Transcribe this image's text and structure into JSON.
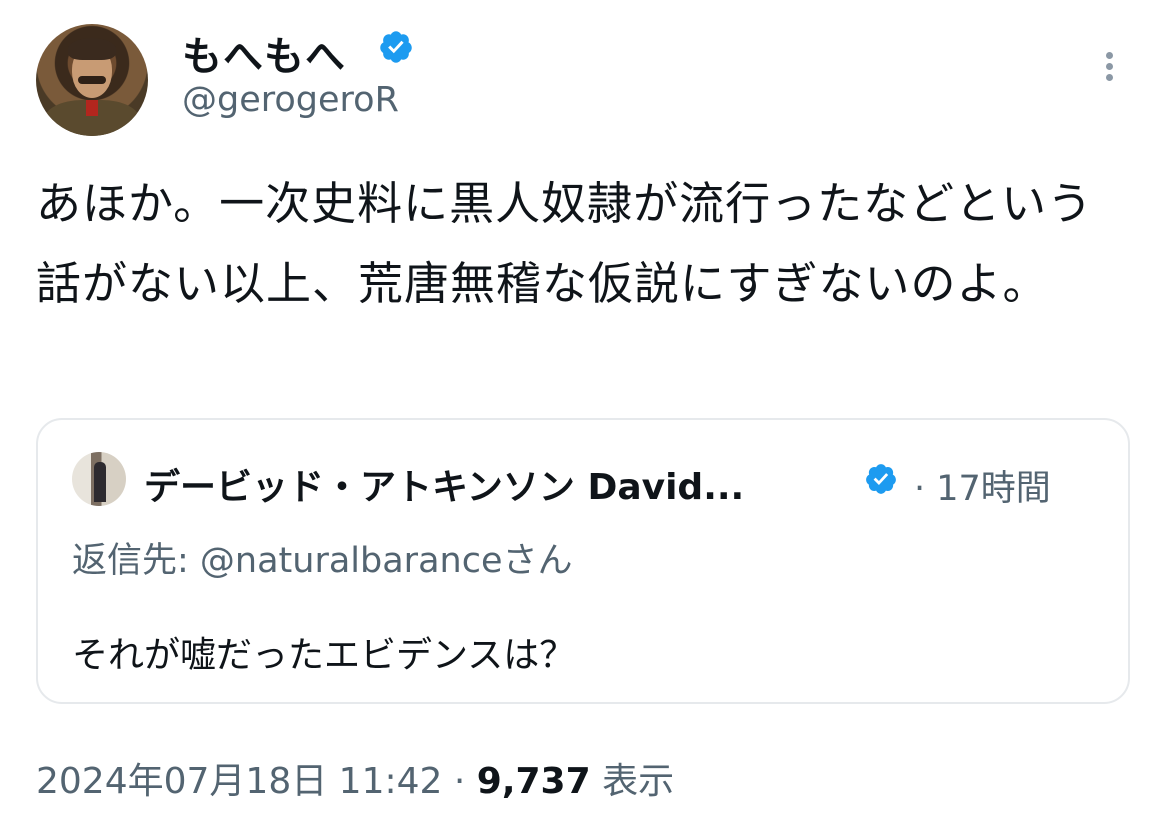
{
  "author": {
    "display_name": "もへもへ",
    "handle": "@gerogeroR",
    "verified": true,
    "avatar_icon": "portrait-avatar"
  },
  "tweet": {
    "text": "あほか。一次史料に黒人奴隷が流行ったなどという話がない以上、荒唐無稽な仮説にすぎないのよ。"
  },
  "quoted_tweet": {
    "display_name": "デービッド・アトキンソン David...",
    "verified": true,
    "time": "· 17時間",
    "reply_to": "返信先: @naturalbaranceさん",
    "text": "それが嘘だったエビデンスは？"
  },
  "meta": {
    "datetime": "2024年07月18日 11:42 · ",
    "views_count": "9,737",
    "views_label": "表示"
  },
  "colors": {
    "verified_blue": "#1d9bf0",
    "secondary_text": "#536471",
    "primary_text": "#0f1419"
  }
}
